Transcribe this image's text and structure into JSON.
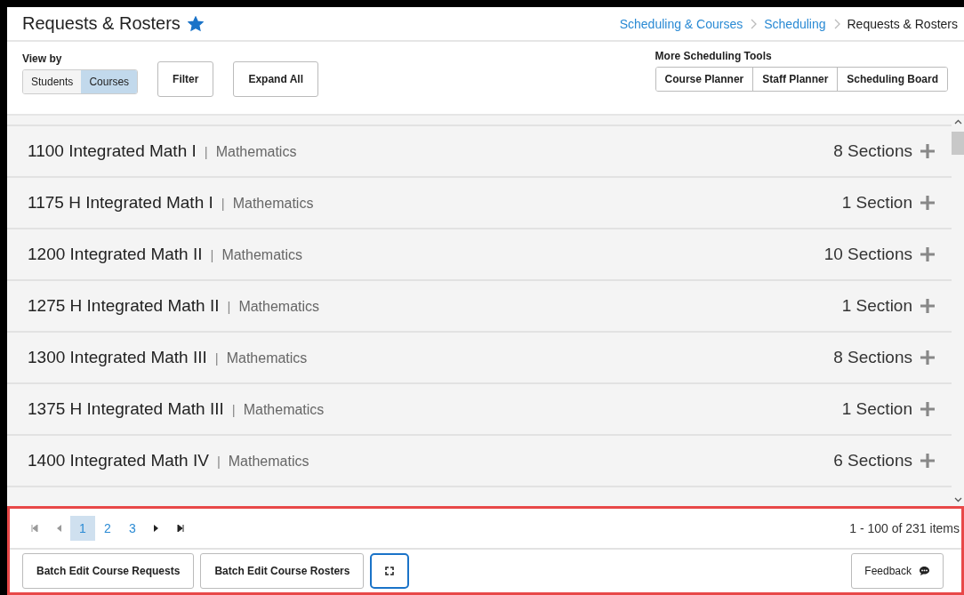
{
  "header": {
    "title": "Requests & Rosters",
    "favorite": true,
    "breadcrumbs": [
      {
        "label": "Scheduling & Courses",
        "link": true
      },
      {
        "label": "Scheduling",
        "link": true
      },
      {
        "label": "Requests & Rosters",
        "link": false
      }
    ]
  },
  "toolbar": {
    "view_by_label": "View by",
    "view_options": [
      {
        "label": "Students",
        "selected": false
      },
      {
        "label": "Courses",
        "selected": true
      }
    ],
    "buttons": [
      "Filter",
      "Expand All"
    ],
    "tools_label": "More Scheduling Tools",
    "tools": [
      "Course Planner",
      "Staff Planner",
      "Scheduling Board"
    ]
  },
  "courses": [
    {
      "name": "1100 Integrated Math I",
      "separator": "|",
      "department": "Mathematics",
      "sections": "8 Sections"
    },
    {
      "name": "1175 H Integrated Math I",
      "separator": "|",
      "department": "Mathematics",
      "sections": "1 Section"
    },
    {
      "name": "1200 Integrated Math II",
      "separator": "|",
      "department": "Mathematics",
      "sections": "10 Sections"
    },
    {
      "name": "1275 H Integrated Math II",
      "separator": "|",
      "department": "Mathematics",
      "sections": "1 Section"
    },
    {
      "name": "1300 Integrated Math III",
      "separator": "|",
      "department": "Mathematics",
      "sections": "8 Sections"
    },
    {
      "name": "1375 H Integrated Math III",
      "separator": "|",
      "department": "Mathematics",
      "sections": "1 Section"
    },
    {
      "name": "1400 Integrated Math IV",
      "separator": "|",
      "department": "Mathematics",
      "sections": "6 Sections"
    }
  ],
  "pager": {
    "pages": [
      {
        "label": "1",
        "selected": true
      },
      {
        "label": "2",
        "selected": false
      },
      {
        "label": "3",
        "selected": false
      }
    ],
    "summary": "1 - 100 of 231 items"
  },
  "footer": {
    "buttons": [
      "Batch Edit Course Requests",
      "Batch Edit Course Rosters"
    ],
    "feedback": "Feedback"
  }
}
